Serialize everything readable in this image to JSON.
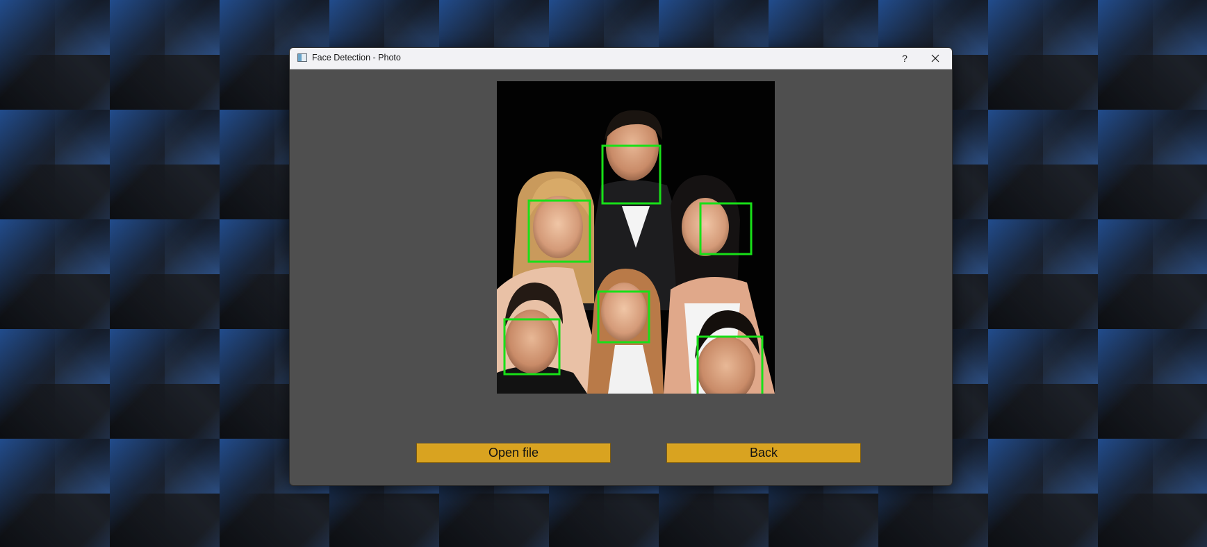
{
  "window": {
    "title": "Face Detection - Photo",
    "help_label": "?",
    "app_icon": "window-app-icon",
    "close_icon": "close-icon"
  },
  "photo": {
    "description_icon": "photo-preview",
    "face_box_color": "#18e018",
    "faces_detected": 6
  },
  "buttons": {
    "open_file": "Open file",
    "back": "Back"
  },
  "colors": {
    "button_bg": "#d9a320",
    "window_bg": "#4f4f4f",
    "titlebar_bg": "#f2f2f5"
  }
}
